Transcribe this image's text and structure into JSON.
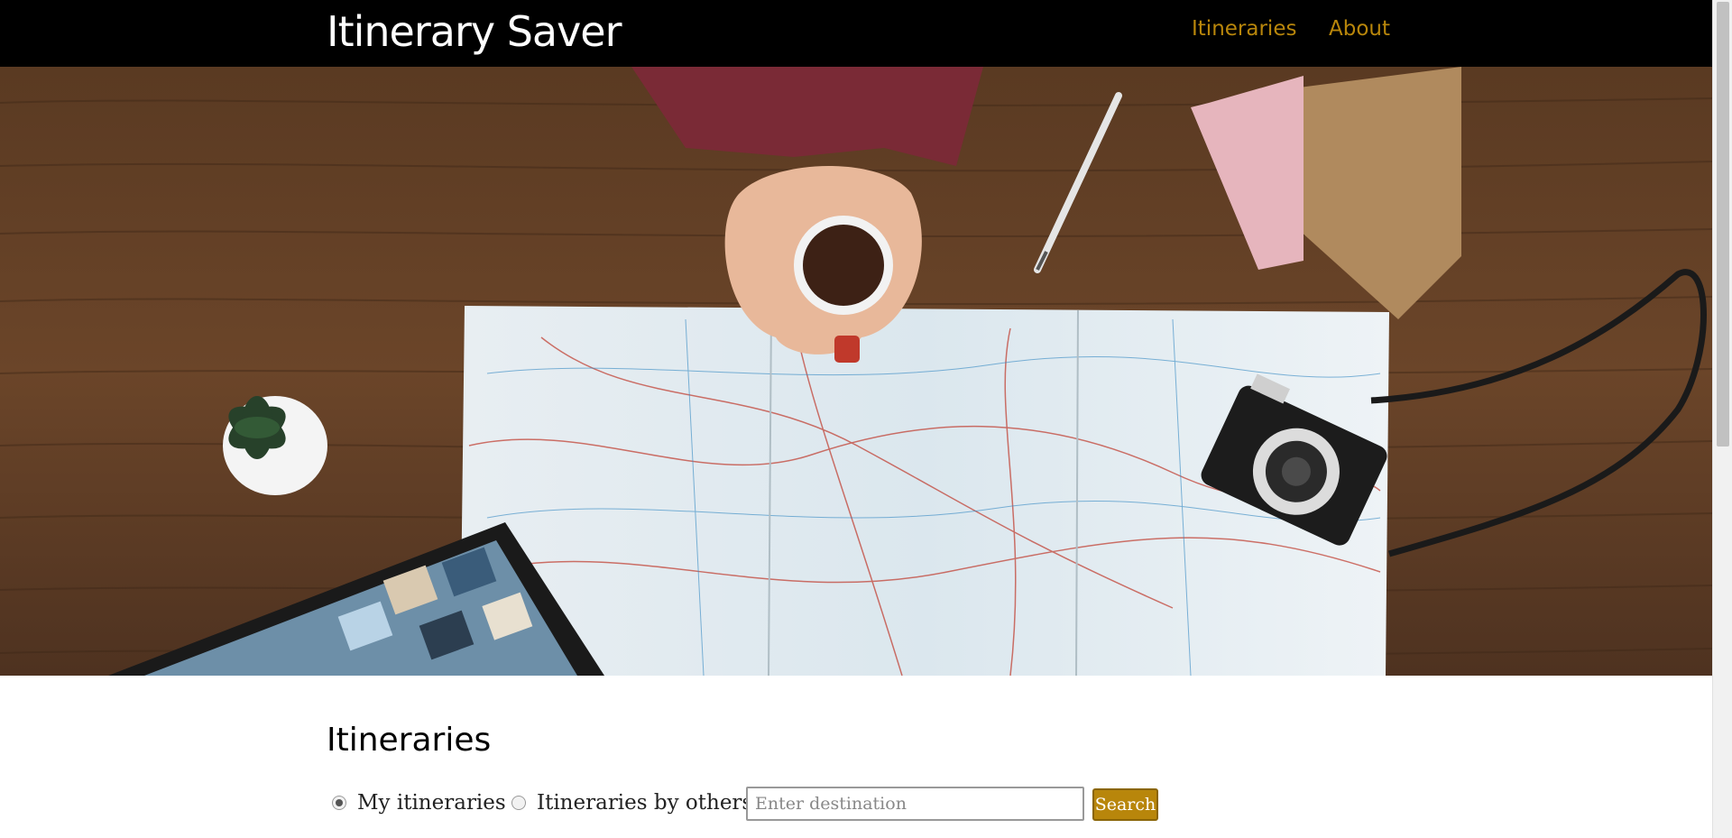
{
  "header": {
    "brand": "Itinerary Saver",
    "nav": [
      {
        "label": "Itineraries"
      },
      {
        "label": "About"
      }
    ]
  },
  "hero": {
    "description_icon": "hero-desk-map-image"
  },
  "main": {
    "title": "Itineraries",
    "filters": {
      "mine_label": "My itineraries",
      "mine_checked": true,
      "others_label": "Itineraries by others",
      "others_checked": false
    },
    "search": {
      "placeholder": "Enter destination",
      "value": "",
      "button_label": "Search"
    }
  },
  "colors": {
    "accent": "#b8860b",
    "navbar_bg": "#000000"
  }
}
